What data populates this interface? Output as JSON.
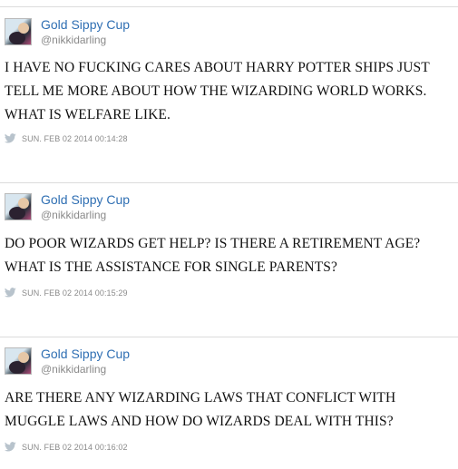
{
  "tweets": [
    {
      "display_name": "Gold Sippy Cup",
      "handle": "@nikkidarling",
      "lines": [
        "I HAVE NO FUCKING CARES ABOUT HARRY POTTER SHIPS JUST",
        "TELL ME MORE ABOUT HOW THE WIZARDING WORLD WORKS.",
        "WHAT IS WELFARE LIKE."
      ],
      "timestamp": "SUN. FEB 02 2014 00:14:28",
      "icon": "twitter-bird-icon"
    },
    {
      "display_name": "Gold Sippy Cup",
      "handle": "@nikkidarling",
      "lines": [
        "DO POOR WIZARDS GET HELP? IS THERE A RETIREMENT AGE?",
        "WHAT IS THE ASSISTANCE FOR SINGLE PARENTS?"
      ],
      "timestamp": "SUN. FEB 02 2014 00:15:29",
      "icon": "twitter-bird-icon"
    },
    {
      "display_name": "Gold Sippy Cup",
      "handle": "@nikkidarling",
      "lines": [
        "ARE THERE ANY WIZARDING LAWS THAT CONFLICT WITH",
        "MUGGLE LAWS AND HOW DO WIZARDS DEAL WITH THIS?"
      ],
      "timestamp": "SUN. FEB 02 2014 00:16:02",
      "icon": "twitter-bird-icon"
    }
  ],
  "colors": {
    "name": "#2f6fb3",
    "handle": "#8a8a8a",
    "text": "#111111",
    "divider": "#dcdcdc",
    "bird": "#b8c3cc"
  }
}
